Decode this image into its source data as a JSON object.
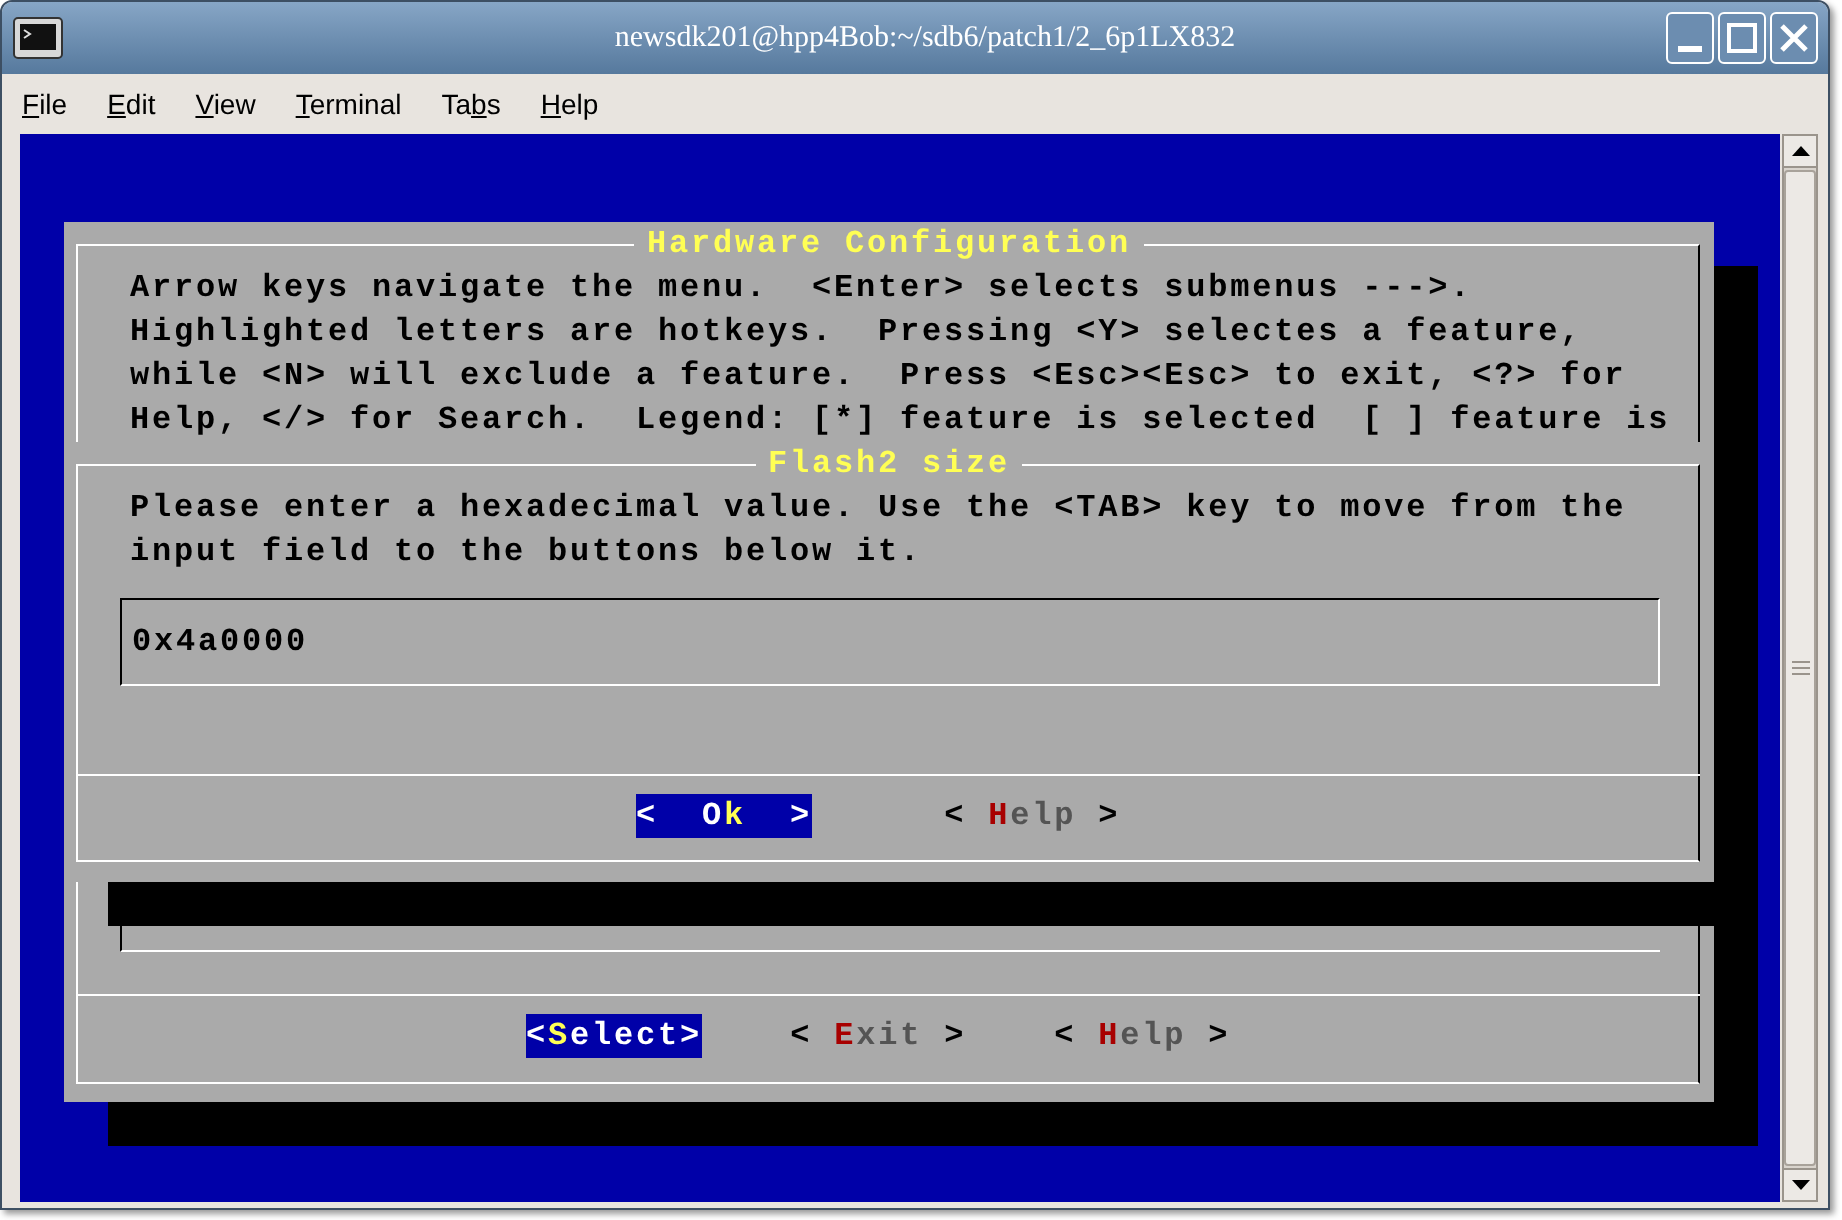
{
  "window": {
    "title": "newsdk201@hpp4Bob:~/sdb6/patch1/2_6p1LX832"
  },
  "menu_bar": [
    {
      "parts": [
        {
          "text": "F",
          "underline": true
        },
        {
          "text": "ile",
          "underline": false
        }
      ]
    },
    {
      "parts": [
        {
          "text": "E",
          "underline": true
        },
        {
          "text": "dit",
          "underline": false
        }
      ]
    },
    {
      "parts": [
        {
          "text": "V",
          "underline": true
        },
        {
          "text": "iew",
          "underline": false
        }
      ]
    },
    {
      "parts": [
        {
          "text": "T",
          "underline": true
        },
        {
          "text": "erminal",
          "underline": false
        }
      ]
    },
    {
      "parts": [
        {
          "text": "Ta",
          "underline": false
        },
        {
          "text": "b",
          "underline": true
        },
        {
          "text": "s",
          "underline": false
        }
      ]
    },
    {
      "parts": [
        {
          "text": "H",
          "underline": true
        },
        {
          "text": "elp",
          "underline": false
        }
      ]
    }
  ],
  "dialog": {
    "title": "Hardware Configuration",
    "help_lines": [
      "Arrow keys navigate the menu.  <Enter> selects submenus --->.",
      "Highlighted letters are hotkeys.  Pressing <Y> selectes a feature,",
      "while <N> will exclude a feature.  Press <Esc><Esc> to exit, <?> for",
      "Help, </> for Search.  Legend: [*] feature is selected  [ ] feature is"
    ],
    "buttons": [
      {
        "selected": true,
        "parts": [
          {
            "kind": "bracket",
            "text": "<"
          },
          {
            "kind": "hot",
            "text": "S"
          },
          {
            "kind": "text",
            "text": "elect"
          },
          {
            "kind": "bracket",
            "text": ">"
          }
        ]
      },
      {
        "selected": false,
        "parts": [
          {
            "kind": "bracket",
            "text": "< "
          },
          {
            "kind": "hot",
            "text": "E"
          },
          {
            "kind": "text",
            "text": "xit"
          },
          {
            "kind": "bracket",
            "text": " >"
          }
        ]
      },
      {
        "selected": false,
        "parts": [
          {
            "kind": "bracket",
            "text": "< "
          },
          {
            "kind": "hot",
            "text": "H"
          },
          {
            "kind": "text",
            "text": "elp"
          },
          {
            "kind": "bracket",
            "text": " >"
          }
        ]
      }
    ]
  },
  "input_dialog": {
    "title": "Flash2 size",
    "prompt_lines": [
      "Please enter a hexadecimal value. Use the <TAB> key to move from the",
      "input field to the buttons below it."
    ],
    "value": "0x4a0000",
    "buttons": [
      {
        "selected": true,
        "parts": [
          {
            "kind": "bracket",
            "text": "<"
          },
          {
            "kind": "text",
            "text": "  O"
          },
          {
            "kind": "hot",
            "text": "k"
          },
          {
            "kind": "bracket",
            "text": "  >"
          }
        ]
      },
      {
        "selected": false,
        "parts": [
          {
            "kind": "bracket",
            "text": "< "
          },
          {
            "kind": "hot",
            "text": "H"
          },
          {
            "kind": "text",
            "text": "elp"
          },
          {
            "kind": "bracket",
            "text": " >"
          }
        ]
      }
    ]
  }
}
